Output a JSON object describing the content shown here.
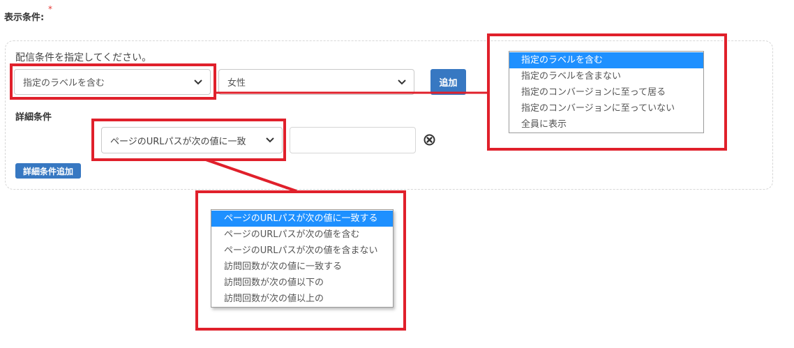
{
  "form": {
    "display_condition_label": "表示条件:",
    "required_mark": "*",
    "instruction": "配信条件を指定してください。",
    "condition_select_value": "指定のラベルを含む",
    "label_select_value": "女性",
    "add_button": "追加",
    "detail_title": "詳細条件",
    "detail_select_value": "ページのURLパスが次の値に一致",
    "detail_input_value": "",
    "detail_add_button": "詳細条件追加"
  },
  "condition_dropdown": {
    "options": [
      "指定のラベルを含む",
      "指定のラベルを含まない",
      "指定のコンバージョンに至って居る",
      "指定のコンバージョンに至っていない",
      "全員に表示"
    ],
    "selected_index": 0
  },
  "detail_dropdown": {
    "options": [
      "ページのURLパスが次の値に一致する",
      "ページのURLパスが次の値を含む",
      "ページのURLパスが次の値を含まない",
      "訪問回数が次の値に一致する",
      "訪問回数が次の値以下の",
      "訪問回数が次の値以上の"
    ],
    "selected_index": 0
  },
  "colors": {
    "accent": "#3778c2",
    "highlight": "#e0202b",
    "selected_option": "#1e90ff"
  },
  "icons": {
    "select_arrow": "chevron-down-icon",
    "remove": "circle-x-icon"
  }
}
